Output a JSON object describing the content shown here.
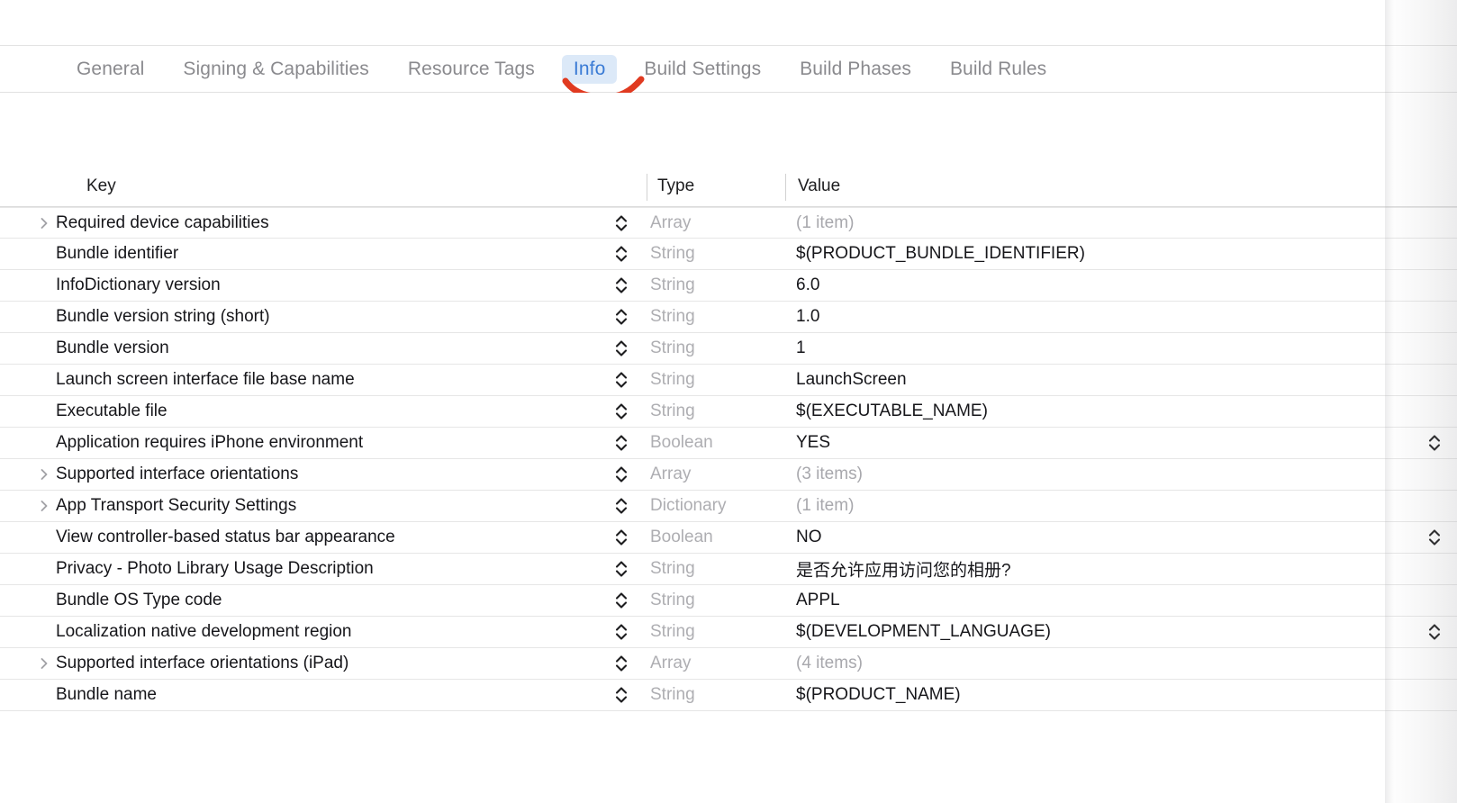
{
  "tabs": [
    {
      "label": "General",
      "active": false
    },
    {
      "label": "Signing & Capabilities",
      "active": false
    },
    {
      "label": "Resource Tags",
      "active": false
    },
    {
      "label": "Info",
      "active": true
    },
    {
      "label": "Build Settings",
      "active": false
    },
    {
      "label": "Build Phases",
      "active": false
    },
    {
      "label": "Build Rules",
      "active": false
    }
  ],
  "annotation": {
    "color": "#e03a20",
    "icon": "red-underline-stroke"
  },
  "table": {
    "columns": [
      "Key",
      "Type",
      "Value"
    ],
    "rows": [
      {
        "key": "Required device capabilities",
        "type": "Array",
        "value": "(1 item)",
        "value_muted": true,
        "expandable": true,
        "stepper": true,
        "right_stepper": false
      },
      {
        "key": "Bundle identifier",
        "type": "String",
        "value": "$(PRODUCT_BUNDLE_IDENTIFIER)",
        "value_muted": false,
        "expandable": false,
        "stepper": true,
        "right_stepper": false
      },
      {
        "key": "InfoDictionary version",
        "type": "String",
        "value": "6.0",
        "value_muted": false,
        "expandable": false,
        "stepper": true,
        "right_stepper": false
      },
      {
        "key": "Bundle version string (short)",
        "type": "String",
        "value": "1.0",
        "value_muted": false,
        "expandable": false,
        "stepper": true,
        "right_stepper": false
      },
      {
        "key": "Bundle version",
        "type": "String",
        "value": "1",
        "value_muted": false,
        "expandable": false,
        "stepper": true,
        "right_stepper": false
      },
      {
        "key": "Launch screen interface file base name",
        "type": "String",
        "value": "LaunchScreen",
        "value_muted": false,
        "expandable": false,
        "stepper": true,
        "right_stepper": false
      },
      {
        "key": "Executable file",
        "type": "String",
        "value": "$(EXECUTABLE_NAME)",
        "value_muted": false,
        "expandable": false,
        "stepper": true,
        "right_stepper": false
      },
      {
        "key": "Application requires iPhone environment",
        "type": "Boolean",
        "value": "YES",
        "value_muted": false,
        "expandable": false,
        "stepper": true,
        "right_stepper": true
      },
      {
        "key": "Supported interface orientations",
        "type": "Array",
        "value": "(3 items)",
        "value_muted": true,
        "expandable": true,
        "stepper": true,
        "right_stepper": false
      },
      {
        "key": "App Transport Security Settings",
        "type": "Dictionary",
        "value": "(1 item)",
        "value_muted": true,
        "expandable": true,
        "stepper": true,
        "right_stepper": false
      },
      {
        "key": "View controller-based status bar appearance",
        "type": "Boolean",
        "value": "NO",
        "value_muted": false,
        "expandable": false,
        "stepper": true,
        "right_stepper": true
      },
      {
        "key": "Privacy - Photo Library Usage Description",
        "type": "String",
        "value": "是否允许应用访问您的相册?",
        "value_muted": false,
        "expandable": false,
        "stepper": true,
        "right_stepper": false
      },
      {
        "key": "Bundle OS Type code",
        "type": "String",
        "value": "APPL",
        "value_muted": false,
        "expandable": false,
        "stepper": true,
        "right_stepper": false
      },
      {
        "key": "Localization native development region",
        "type": "String",
        "value": "$(DEVELOPMENT_LANGUAGE)",
        "value_muted": false,
        "expandable": false,
        "stepper": true,
        "right_stepper": true
      },
      {
        "key": "Supported interface orientations (iPad)",
        "type": "Array",
        "value": "(4 items)",
        "value_muted": true,
        "expandable": true,
        "stepper": true,
        "right_stepper": false
      },
      {
        "key": "Bundle name",
        "type": "String",
        "value": "$(PRODUCT_NAME)",
        "value_muted": false,
        "expandable": false,
        "stepper": true,
        "right_stepper": false
      }
    ]
  }
}
